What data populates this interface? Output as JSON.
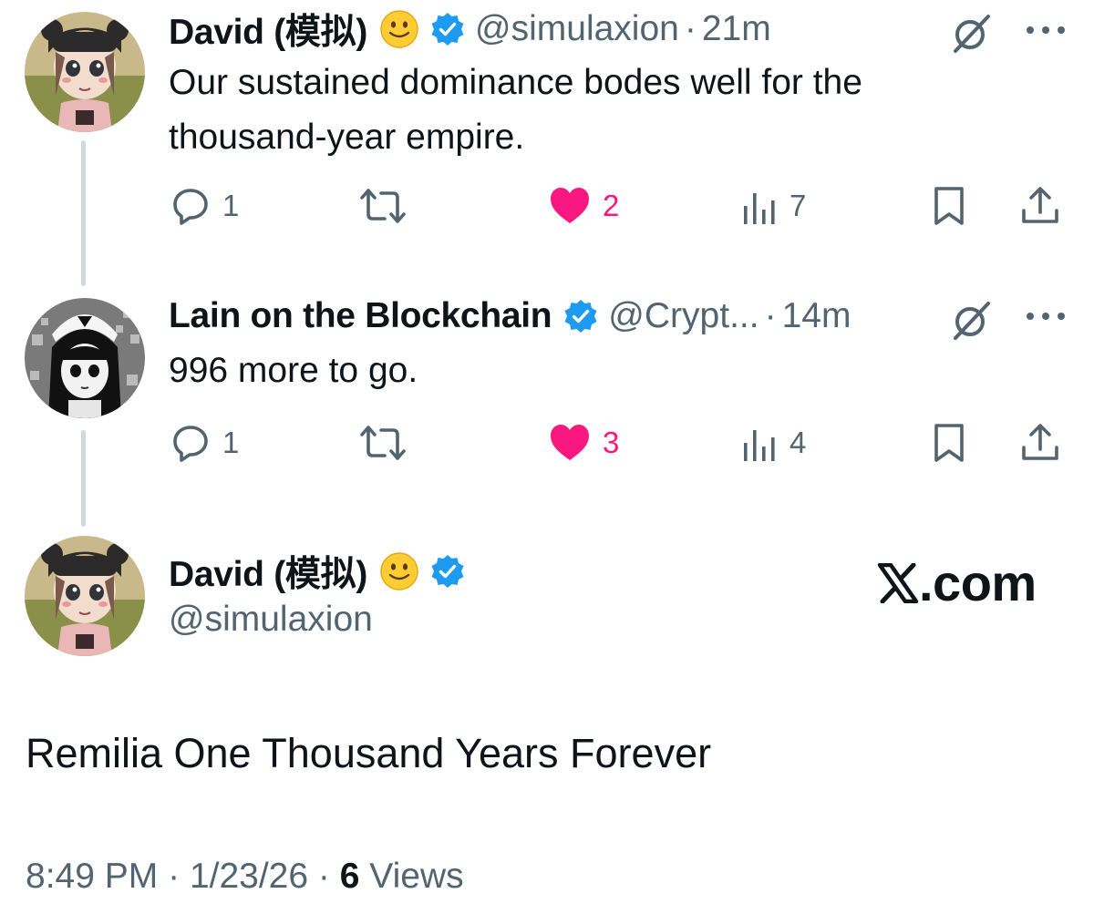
{
  "colors": {
    "text": "#0f1419",
    "secondary": "#536471",
    "like": "#f91880",
    "verified": "#1d9bf0",
    "thread_line": "#cfd9de"
  },
  "tweets": [
    {
      "author_name": "David (模拟)",
      "author_emoji": "slightly-smiling-face-emoji",
      "verified": true,
      "handle": "@simulaxion",
      "separator": "·",
      "time": "21m",
      "text_lines": [
        "Our sustained dominance bodes well for the",
        "thousand-year empire."
      ],
      "replies": "1",
      "likes": "2",
      "views": "7"
    },
    {
      "author_name": "Lain on the Blockchain",
      "verified": true,
      "handle": "@Crypt...",
      "separator": "·",
      "time": "14m",
      "text": "996 more to go.",
      "replies": "1",
      "likes": "3",
      "views": "4"
    }
  ],
  "main_tweet": {
    "author_name": "David (模拟)",
    "author_emoji": "slightly-smiling-face-emoji",
    "verified": true,
    "handle": "@simulaxion",
    "text": "Remilia One Thousand Years Forever",
    "brand": ".com",
    "footer_time": "8:49 PM",
    "footer_sep1": "·",
    "footer_date": "1/23/26",
    "footer_sep2": "·",
    "footer_views_count": "6",
    "footer_views_label": "Views"
  }
}
